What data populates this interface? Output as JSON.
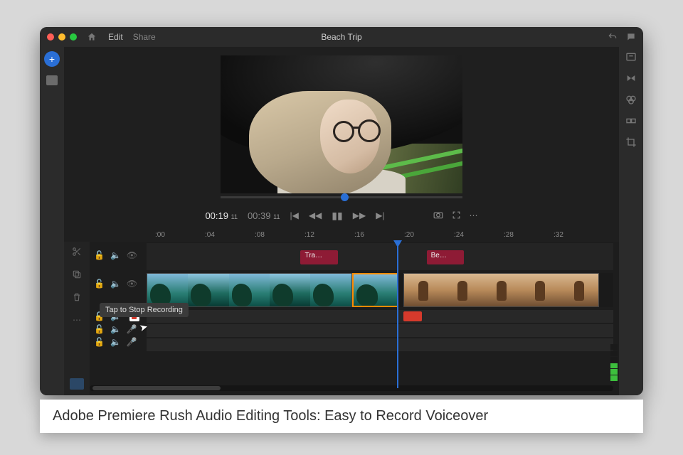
{
  "window": {
    "title": "Beach Trip",
    "tabs": [
      "Edit",
      "Share"
    ]
  },
  "playback": {
    "current_time": "00:19",
    "current_frames": "11",
    "total_time": "00:39",
    "total_frames": "11"
  },
  "ruler_ticks": [
    ":00",
    ":04",
    ":08",
    ":12",
    ":16",
    ":20",
    ":24",
    ":28",
    ":32"
  ],
  "title_clips": [
    {
      "label": "Tra…",
      "start_pct": 33,
      "width_pct": 8
    },
    {
      "label": "Be…",
      "start_pct": 60,
      "width_pct": 8
    }
  ],
  "tooltip": "Tap to Stop Recording",
  "audio": {
    "recorded_segment": {
      "start_pct": 55,
      "width_pct": 4
    }
  },
  "right_rail_icons": [
    "titles-icon",
    "transitions-icon",
    "color-icon",
    "speed-icon",
    "crop-icon"
  ],
  "left_tools": [
    "scissors-icon",
    "duplicate-icon",
    "delete-icon",
    "more-icon"
  ],
  "caption": "Adobe Premiere Rush Audio Editing Tools: Easy to Record Voiceover"
}
